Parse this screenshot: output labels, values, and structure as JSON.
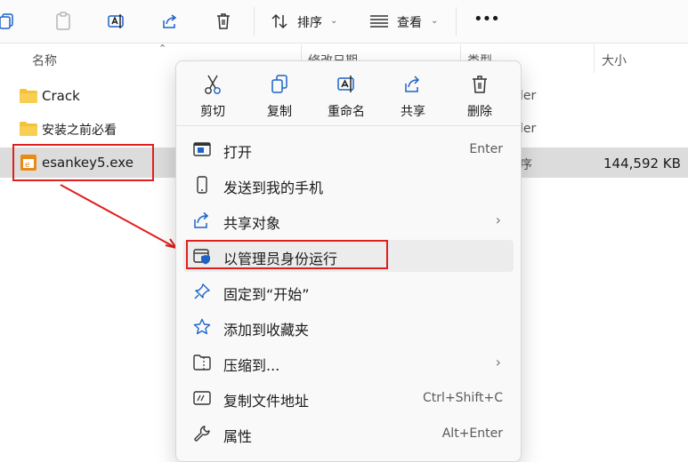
{
  "toolbar": {
    "sort_label": "排序",
    "view_label": "查看",
    "more_label": "•••"
  },
  "columns": {
    "name": "名称",
    "modified": "修改日期",
    "type": "类型",
    "size": "大小"
  },
  "files": [
    {
      "name": "Crack",
      "type_partial": "ler",
      "size": ""
    },
    {
      "name": "安装之前必看",
      "type_partial": "ler",
      "size": ""
    },
    {
      "name": "esankey5.exe",
      "type_partial": "序",
      "size": "144,592 KB"
    }
  ],
  "context_menu": {
    "quick_actions": [
      {
        "label": "剪切",
        "icon": "scissors-icon"
      },
      {
        "label": "复制",
        "icon": "copy-icon"
      },
      {
        "label": "重命名",
        "icon": "rename-icon"
      },
      {
        "label": "共享",
        "icon": "share-icon"
      },
      {
        "label": "删除",
        "icon": "trash-icon"
      }
    ],
    "items": [
      {
        "label": "打开",
        "shortcut": "Enter",
        "icon": "open-app-icon"
      },
      {
        "label": "发送到我的手机",
        "shortcut": "",
        "icon": "phone-icon"
      },
      {
        "label": "共享对象",
        "shortcut": "",
        "icon": "share-icon",
        "arrow": "›"
      },
      {
        "label": "以管理员身份运行",
        "shortcut": "",
        "icon": "admin-shield-icon"
      },
      {
        "label": "固定到“开始”",
        "shortcut": "",
        "icon": "pin-icon"
      },
      {
        "label": "添加到收藏夹",
        "shortcut": "",
        "icon": "star-icon"
      },
      {
        "label": "压缩到...",
        "shortcut": "",
        "icon": "zip-icon",
        "arrow": "›"
      },
      {
        "label": "复制文件地址",
        "shortcut": "Ctrl+Shift+C",
        "icon": "path-icon"
      },
      {
        "label": "属性",
        "shortcut": "Alt+Enter",
        "icon": "wrench-icon"
      }
    ]
  },
  "colors": {
    "annotation_red": "#e01f1f",
    "folder_yellow": "#f3c13a",
    "accent_blue": "#1c63c9"
  }
}
